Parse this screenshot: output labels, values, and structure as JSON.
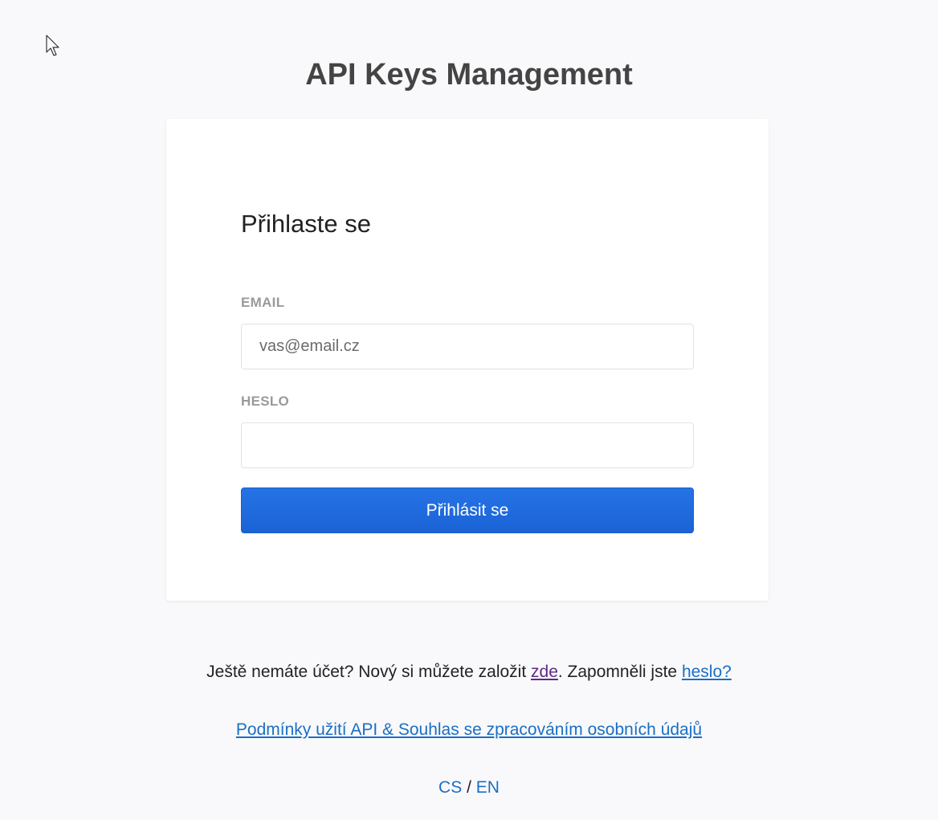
{
  "app": {
    "title": "API Keys Management"
  },
  "login_form": {
    "heading": "Přihlaste se",
    "email_label": "EMAIL",
    "email_placeholder": "vas@email.cz",
    "email_value": "",
    "password_label": "HESLO",
    "password_value": "",
    "submit_label": "Přihlásit se"
  },
  "footer": {
    "signup_text_before": "Ještě nemáte účet? Nový si můžete založit ",
    "signup_link": "zde",
    "signup_text_after": ". Zapomněli jste ",
    "forgot_link": "heslo?",
    "terms_link": "Podmínky užití API & Souhlas se zpracováním osobních údajů",
    "lang_cs": "CS",
    "lang_separator": " / ",
    "lang_en": "EN"
  },
  "colors": {
    "background": "#f9f9fb",
    "primary_button": "#1a63d6",
    "link": "#1a6fc4",
    "visited_link": "#5b2a86"
  },
  "icons": {
    "cursor": "mouse-pointer-icon"
  }
}
